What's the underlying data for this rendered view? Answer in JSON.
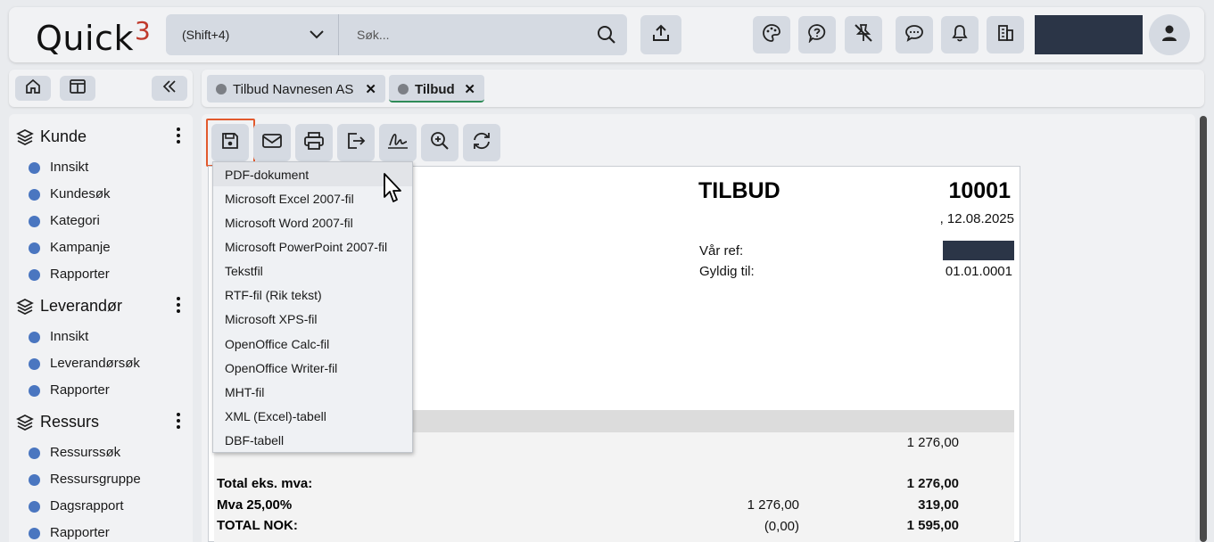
{
  "app": {
    "logo_text": "Quick",
    "logo_sup": "3",
    "brand_color": "#c0392b"
  },
  "search": {
    "shortcut": "(Shift+4)",
    "placeholder": "Søk..."
  },
  "header_icons": [
    "upload-icon",
    "palette-icon",
    "help-icon",
    "no-pin-icon",
    "chat-icon",
    "bell-icon",
    "building-icon",
    "user-icon"
  ],
  "sidebar": {
    "sections": [
      {
        "title": "Kunde",
        "items": [
          "Innsikt",
          "Kundesøk",
          "Kategori",
          "Kampanje",
          "Rapporter"
        ]
      },
      {
        "title": "Leverandør",
        "items": [
          "Innsikt",
          "Leverandørsøk",
          "Rapporter"
        ]
      },
      {
        "title": "Ressurs",
        "items": [
          "Ressurssøk",
          "Ressursgruppe",
          "Dagsrapport",
          "Rapporter"
        ]
      }
    ]
  },
  "tabs": [
    {
      "label": "Tilbud Navnesen AS",
      "active": false
    },
    {
      "label": "Tilbud",
      "active": true
    }
  ],
  "doc_toolbar": [
    "save-icon",
    "email-icon",
    "print-icon",
    "export-icon",
    "signature-icon",
    "zoom-in-icon",
    "refresh-icon"
  ],
  "export_menu": {
    "items": [
      "PDF-dokument",
      "Microsoft Excel 2007-fil",
      "Microsoft Word 2007-fil",
      "Microsoft PowerPoint 2007-fil",
      "Tekstfil",
      "RTF-fil (Rik tekst)",
      "Microsoft XPS-fil",
      "OpenOffice Calc-fil",
      "OpenOffice Writer-fil",
      "MHT-fil",
      "XML (Excel)-tabell",
      "DBF-tabell"
    ],
    "hovered_index": 0
  },
  "document": {
    "title": "TILBUD",
    "number": "10001",
    "date": ", 12.08.2025",
    "our_ref_label": "Vår ref:",
    "valid_until_label": "Gyldig til:",
    "valid_until_value": "01.01.0001",
    "line_amount": "1 276,00",
    "total_ex_label": "Total eks. mva:",
    "total_ex_value": "1 276,00",
    "vat_label": "Mva 25,00%",
    "vat_base": "1 276,00",
    "vat_value": "319,00",
    "total_label": "TOTAL NOK:",
    "rounding": "(0,00)",
    "total_value": "1 595,00"
  }
}
